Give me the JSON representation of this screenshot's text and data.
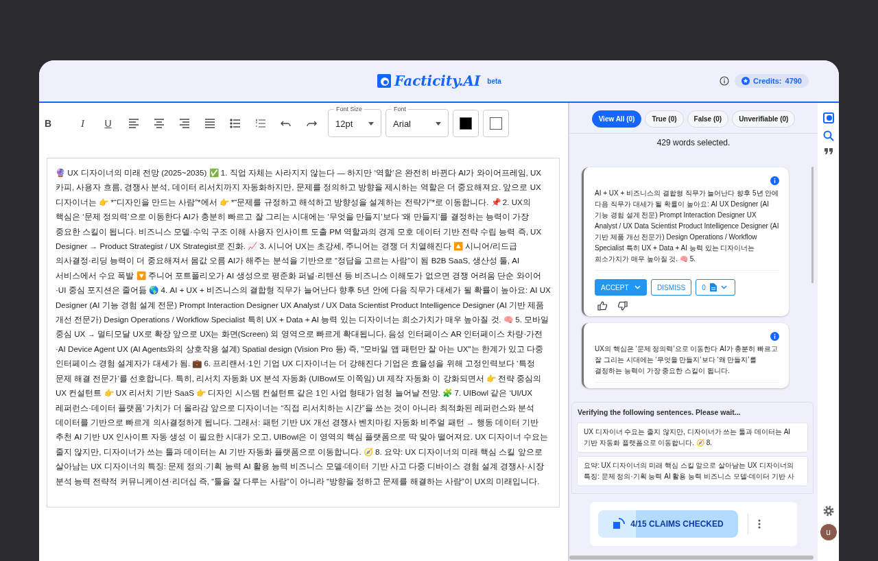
{
  "header": {
    "logo": "Facticity.AI",
    "badge": "beta",
    "credits_label": "Credits:",
    "credits_value": "4790"
  },
  "toolbar": {
    "format_buttons": [
      "B",
      "I",
      "U"
    ],
    "font_size": {
      "label": "Font Size",
      "value": "12pt"
    },
    "font": {
      "label": "Font",
      "value": "Arial"
    },
    "swatches": [
      {
        "color": "#000000"
      },
      {
        "color": "#ffffff"
      }
    ]
  },
  "editor": {
    "text": "🔮 UX 디자이너의 미래 전망 (2025~2035) ✅ 1. 직업 자체는 사라지지 않는다 — 하지만 ‘역할’은 완전히 바뀐다 AI가 와이어프레임, UX 카피, 사용자 흐름, 경쟁사 분석, 데이터 리서치까지 자동화하지만, 문제를 정의하고 방향을 제시하는 역할은 더 중요해져요. 앞으로 UX 디자이너는 👉 *“디자인을 만드는 사람”*에서 👉 *“문제를 규정하고 해석하고 방향성을 설계하는 전략가”*로 이동합니다. 📌 2. UX의 핵심은 ‘문제 정의력’으로 이동한다 AI가 충분히 빠르고 잘 그리는 시대에는 ‘무엇을 만들지’보다 ‘왜 만들지’를 결정하는 능력이 가장 중요한 스킬이 됩니다. 비즈니스 모델·수익 구조 이해 사용자 인사이트 도출 PM 역할과의 경계 모호 데이터 기반 전략 수립 능력 즉, UX Designer → Product Strategist / UX Strategist로 진화. 📈 3. 시니어 UX는 초강세, 주니어는 경쟁 더 치열해진다 🔼 시니어/리드급 의사결정·리딩 능력이 더 중요해져서 몸값 오름 AI가 해주는 분석을 기반으로 “정답을 고르는 사람”이 됨 B2B SaaS, 생산성 툴, AI 서비스에서 수요 폭발 🔽 주니어 포트폴리오가 AI 생성으로 평준화 퍼널·리텐션 등 비즈니스 이해도가 없으면 경쟁 어려움 단순 와이어·UI 중심 포지션은 줄어듦 🌎 4. AI + UX + 비즈니스의 결합형 직무가 늘어난다 향후 5년 안에 다음 직무가 대세가 될 확률이 높아요: AI UX Designer (AI 기능 경험 설계 전문) Prompt Interaction Designer UX Analyst / UX Data Scientist Product Intelligence Designer (AI 기반 제품 개선 전문가) Design Operations / Workflow Specialist 특히 UX + Data + AI 능력 있는 디자이너는 희소가치가 매우 높아질 것. 🧠 5. 모바일 중심 UX → 멀티모달 UX로 확장 앞으로 UX는 화면(Screen) 외 영역으로 빠르게 확대됩니다. 음성 인터페이스 AR 인터페이스 차량·가전·AI Device Agent UX (AI Agents와의 상호작용 설계) Spatial design (Vision Pro 등) 즉, \"모바일 앱 패턴만 잘 아는 UX\"는 한계가 있고 다중 인터페이스 경험 설계자가 대세가 됨. 💼 6. 프리랜서·1인 기업 UX 디자이너는 더 강해진다 기업은 효율성을 위해 고정인력보다 ‘특정 문제 해결 전문가’를 선호합니다. 특히, 리서치 자동화 UX 분석 자동화 (UIBowl도 이쪽임) UI 제작 자동화 이 강화되면서 👉 전략 중심의 UX 컨설턴트 👉 UX 리서치 기반 SaaS 👉 디자인 시스템 컨설턴트 같은 1인 사업 형태가 엄청 늘어날 전망. 🧩 7. UIBowl 같은 ‘UI/UX 레퍼런스·데이터 플랫폼’ 가치가 더 올라감 앞으로 디자이너는 “직접 리서치하는 시간”을 쓰는 것이 아니라 최적화된 레퍼런스와 분석 데이터를 기반으로 빠르게 의사결정하게 됩니다. 그래서: 패턴 기반 UX 개선 경쟁사 벤치마킹 자동화 비주얼 패턴 → 행동 데이터 기반 추천 AI 기반 UX 인사이트 자동 생성 이 필요한 시대가 오고, UIBowl은 이 영역의 핵심 플랫폼으로 딱 맞아 떨어져요. UX 디자이너 수요는 줄지 않지만, 디자이너가 쓰는 툴과 데이터는 AI 기반 자동화 플랫폼으로 이동합니다. 🧭 8. 요약: UX 디자이너의 미래 핵심 스킬 앞으로 살아남는 UX 디자이너의 특징: 문제 정의·기획 능력 AI 활용 능력 비즈니스 모델·데이터 기반 사고 다중 디바이스 경험 설계 경쟁사·시장 분석 능력 전략적 커뮤니케이션·리더십 즉, “툴을 잘 다루는 사람”이 아니라 “방향을 정하고 문제를 해결하는 사람”이 UX의 미래입니다."
  },
  "filters": [
    {
      "label": "View All (0)",
      "selected": true
    },
    {
      "label": "True (0)",
      "selected": false
    },
    {
      "label": "False (0)",
      "selected": false
    },
    {
      "label": "Unverifiable (0)",
      "selected": false
    }
  ],
  "word_count": "429 words selected.",
  "claims": [
    {
      "text": "AI + UX + 비즈니스의 결합형 직무가 늘어난다 향후 5년 안에 다음 직무가 대세가 될 확률이 높아요: AI UX Designer (AI 기능 경험 설계 전문) Prompt Interaction Designer UX Analyst / UX Data Scientist Product Intelligence Designer (AI 기반 제품 개선 전문가) Design Operations / Workflow Specialist 특히 UX + Data + AI 능력 있는 디자이너는 희소가치가 매우 높아질 것. 🧠 5.",
      "actions": {
        "accept": "ACCEPT",
        "dismiss": "DISMISS",
        "sources": "0"
      }
    },
    {
      "text": "UX의 핵심은 ‘문제 정의력’으로 이동한다 AI가 충분히 빠르고 잘 그리는 시대에는 ‘무엇을 만들지’보다 ‘왜 만들지’를 결정하는 능력이 가장 중요한 스킬이 됩니다."
    }
  ],
  "verifying": {
    "title": "Verifying the following sentences. Please wait...",
    "sentences": [
      "UX 디자이너 수요는 줄지 않지만, 디자이너가 쓰는 툴과 데이터는 AI 기반 자동화 플랫폼으로 이동합니다. 🧭 8.",
      "요약: UX 디자이너의 미래 핵심 스킬 앞으로 살아남는 UX 디자이너의 특징: 문제 정의·기획 능력 AI 활용 능력 비즈니스 모델·데이터 기반 사"
    ]
  },
  "progress": {
    "label": "4/15 CLAIMS CHECKED",
    "level": 0.27
  },
  "avatar": "u"
}
